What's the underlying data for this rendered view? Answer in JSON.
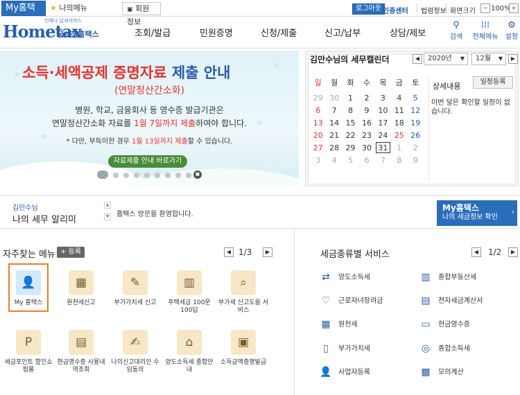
{
  "util": {
    "my_tab": "My홈택스",
    "my_menu": "나의메뉴",
    "member_info": "회원정보",
    "logout": "로그아웃",
    "auth_center": "인증센터",
    "legal_info": "법령정보",
    "screen_size": "화면크기",
    "zoom": "100%"
  },
  "header": {
    "logo_text": "Hometax",
    "logo_sub_small": "언제나 납세서비스",
    "logo_sub": "국세청홈택스",
    "nav": [
      "조회/발급",
      "민원증명",
      "신청/제출",
      "신고/납부",
      "상담/제보"
    ],
    "icons": [
      {
        "label": "검색",
        "icon": "search-icon"
      },
      {
        "label": "전체메뉴",
        "icon": "grid-icon"
      },
      {
        "label": "설정",
        "icon": "gear-icon"
      }
    ]
  },
  "banner": {
    "title_a": "소득·세액공제 증명자료",
    "title_b": "제출 안내",
    "subtitle": "(연말정산간소화)",
    "line1": "병원, 학교, 금융회사 등 영수증 발급기관은",
    "line2_a": "연말정산간소화 자료를",
    "line2_b": "1월 7일까지 제출",
    "line2_c": "하여야 합니다.",
    "note_a": "* 다만, 부득이한 경우",
    "note_b": "1월 13일까지 제출",
    "note_c": "할 수 있습니다.",
    "button": "자료제출 안내 바로가기"
  },
  "calendar": {
    "title": "김만수님의 세무캘린더",
    "year": "2020년",
    "month": "12월",
    "weekdays": [
      "일",
      "월",
      "화",
      "수",
      "목",
      "금",
      "토"
    ],
    "weeks": [
      [
        "29",
        "30",
        "1",
        "2",
        "3",
        "4",
        "5"
      ],
      [
        "6",
        "7",
        "8",
        "9",
        "10",
        "11",
        "12"
      ],
      [
        "13",
        "14",
        "15",
        "16",
        "17",
        "18",
        "19"
      ],
      [
        "20",
        "21",
        "22",
        "23",
        "24",
        "25",
        "26"
      ],
      [
        "27",
        "28",
        "29",
        "30",
        "31",
        "1",
        "2"
      ],
      [
        "3",
        "4",
        "5",
        "6",
        "7",
        "8",
        "9"
      ]
    ],
    "selected_day": "31",
    "detail_label": "상세내용",
    "schedule_button": "일정등록",
    "empty_message": "이번 달은 확인할 일정이 없습니다."
  },
  "notice": {
    "user": "김만수님",
    "title": "나의 세무 알리미",
    "message": "홈택스 방문을 환영합니다.",
    "my_btn_title": "My홈택스",
    "my_btn_sub": "나의 세금정보 확인"
  },
  "frequent": {
    "title": "자주찾는 메뉴",
    "add_label": "등록",
    "page": "1/3",
    "items": [
      {
        "label": "My 홈택스",
        "icon": "user-icon"
      },
      {
        "label": "원천세신고",
        "icon": "calendar-icon"
      },
      {
        "label": "부가가치세 신고",
        "icon": "vat-doc-icon"
      },
      {
        "label": "주택세금 100문100답",
        "icon": "building-icon"
      },
      {
        "label": "부가세 신고도움 서비스",
        "icon": "vat-search-icon"
      },
      {
        "label": "세금포인트 할인쇼핑몰",
        "icon": "point-bag-icon"
      },
      {
        "label": "현금영수증 사용내역조회",
        "icon": "receipt-icon"
      },
      {
        "label": "나의신고대리인 수임동의",
        "icon": "pen-doc-icon"
      },
      {
        "label": "양도소득세 종합안내",
        "icon": "house-icon"
      },
      {
        "label": "소득금액증명발급",
        "icon": "certificate-icon"
      }
    ]
  },
  "services": {
    "title": "세금종류별 서비스",
    "page": "1/2",
    "items": [
      {
        "label": "양도소득세",
        "icon": "transfer-doc-icon"
      },
      {
        "label": "종합부동산세",
        "icon": "buildings-icon"
      },
      {
        "label": "근로자녀장려금",
        "icon": "heart-hand-icon"
      },
      {
        "label": "전자세금계산서",
        "icon": "invoice-icon"
      },
      {
        "label": "원천세",
        "icon": "tax-slip-icon"
      },
      {
        "label": "현금영수증",
        "icon": "cash-icon"
      },
      {
        "label": "부가가치세",
        "icon": "vat-icon"
      },
      {
        "label": "종합소득세",
        "icon": "coins-icon"
      },
      {
        "label": "사업자등록",
        "icon": "person-icon"
      },
      {
        "label": "모의계산",
        "icon": "calculator-icon"
      }
    ]
  }
}
